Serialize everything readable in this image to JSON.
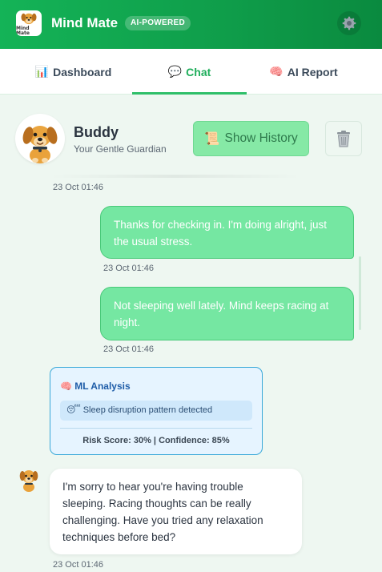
{
  "header": {
    "logo_text": "Mind Mate",
    "app_title": "Mind Mate",
    "badge": "AI-POWERED",
    "settings_icon": "gear-icon",
    "brand_color": "#14b357"
  },
  "tabs": [
    {
      "label": "Dashboard",
      "icon": "📊",
      "active": false
    },
    {
      "label": "Chat",
      "icon": "💬",
      "active": true
    },
    {
      "label": "AI Report",
      "icon": "🧠",
      "active": false
    }
  ],
  "companion": {
    "name": "Buddy",
    "subtitle": "Your Gentle Guardian",
    "history_button": "Show History",
    "history_icon": "📜",
    "clear_icon": "🗑️"
  },
  "messages": [
    {
      "sender": "bot",
      "time": "23 Oct 01:46"
    },
    {
      "sender": "user",
      "text": "Thanks for checking in. I'm doing alright, just the usual stress.",
      "time": "23 Oct 01:46"
    },
    {
      "sender": "user",
      "text": "Not sleeping well lately. Mind keeps racing at night.",
      "time": "23 Oct 01:46"
    },
    {
      "sender": "bot",
      "text": "I'm sorry to hear you're having trouble sleeping. Racing thoughts can be really challenging. Have you tried any relaxation techniques before bed?",
      "time": "23 Oct 01:46"
    }
  ],
  "ml_analysis": {
    "title": "ML Analysis",
    "icon": "🧠",
    "finding_icon": "😴",
    "finding": "Sleep disruption pattern detected",
    "risk_line": "Risk Score: 30% | Confidence: 85%"
  }
}
